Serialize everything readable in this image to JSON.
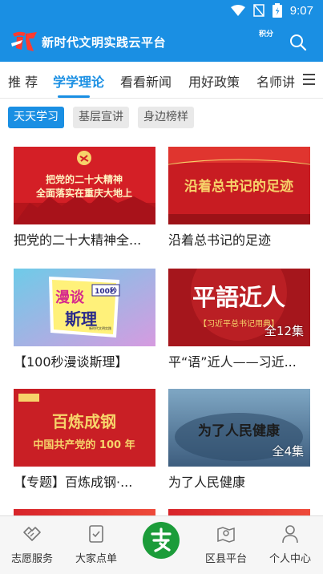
{
  "status_bar": {
    "time": "9:07"
  },
  "header": {
    "title": "新时代文明实践云平台",
    "points_label": "积分"
  },
  "tabs": [
    {
      "label": "推 荐",
      "active": false
    },
    {
      "label": "学学理论",
      "active": true
    },
    {
      "label": "看看新闻",
      "active": false
    },
    {
      "label": "用好政策",
      "active": false
    },
    {
      "label": "名师讲",
      "active": false
    }
  ],
  "chips": [
    {
      "label": "天天学习",
      "active": true
    },
    {
      "label": "基层宣讲",
      "active": false
    },
    {
      "label": "身边榜样",
      "active": false
    }
  ],
  "cards": [
    {
      "title": "把党的二十大精神全...",
      "thumb_text": [
        "把党的二十大精神",
        "全面落实在重庆大地上"
      ],
      "badge": ""
    },
    {
      "title": "沿着总书记的足迹",
      "thumb_text": [
        "沿着总书记的足迹"
      ],
      "badge": ""
    },
    {
      "title": "【100秒漫谈斯理】",
      "thumb_text": [
        "漫谈",
        "斯理",
        "100秒",
        "新时代文明实践"
      ],
      "badge": ""
    },
    {
      "title": "平“语”近人——习近...",
      "thumb_text": [
        "平語近人",
        "【习近平总书记用典】"
      ],
      "badge": "全12集"
    },
    {
      "title": "【专题】百炼成钢·...",
      "thumb_text": [
        "百炼成钢",
        "中国共产党的 100 年"
      ],
      "badge": ""
    },
    {
      "title": "为了人民健康",
      "thumb_text": [
        "为了人民健康"
      ],
      "badge": "全4集"
    }
  ],
  "bottom_nav": [
    {
      "label": "志愿服务",
      "icon": "handshake-icon"
    },
    {
      "label": "大家点单",
      "icon": "checklist-icon"
    },
    {
      "label": "",
      "icon": "center-logo-icon"
    },
    {
      "label": "区县平台",
      "icon": "map-pin-icon"
    },
    {
      "label": "个人中心",
      "icon": "person-icon"
    }
  ],
  "colors": {
    "accent": "#1a8fe3",
    "red": "#d8242a",
    "gold": "#f7d36a",
    "green": "#1c9c3a"
  }
}
